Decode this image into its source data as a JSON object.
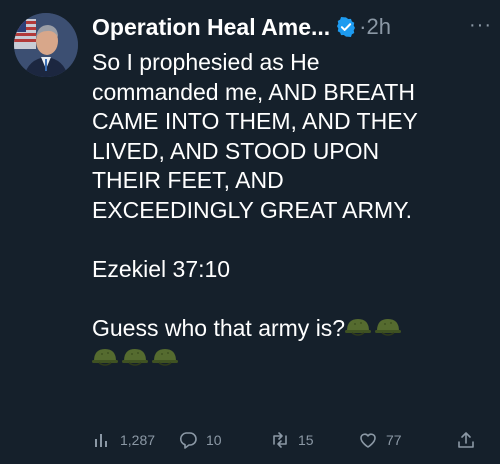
{
  "tweet": {
    "display_name": "Operation Heal Ame...",
    "separator": "·",
    "time": "2h",
    "more_label": "···",
    "lines": [
      "So I prophesied as He",
      "commanded me, AND BREATH",
      "CAME INTO THEM, AND THEY",
      "LIVED, AND STOOD UPON",
      "THEIR FEET, AND",
      "EXCEEDINGLY GREAT ARMY.",
      "",
      "Ezekiel 37:10",
      "",
      "Guess who that army is?"
    ],
    "emoji_name": "military-helmet",
    "emoji_count": 5
  },
  "actions": {
    "views": "1,287",
    "replies": "10",
    "retweets": "15",
    "likes": "77"
  },
  "colors": {
    "background": "#15202b",
    "text": "#ffffff",
    "muted": "#8b98a5",
    "verified": "#1d9bf0"
  },
  "icons": [
    "views-icon",
    "reply-icon",
    "retweet-icon",
    "like-icon",
    "share-icon",
    "verified-badge-icon",
    "military-helmet-emoji"
  ]
}
